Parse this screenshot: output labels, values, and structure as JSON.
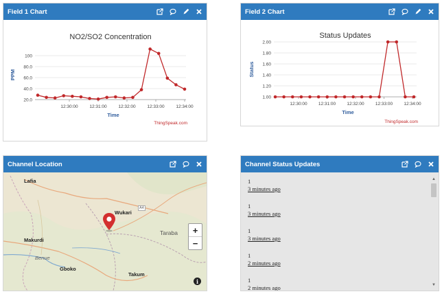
{
  "widgets": {
    "field1": {
      "title": "Field 1 Chart"
    },
    "field2": {
      "title": "Field 2 Chart"
    },
    "location": {
      "title": "Channel Location"
    },
    "status": {
      "title": "Channel Status Updates"
    }
  },
  "icons": {
    "external": "external-link-icon",
    "comment": "comment-icon",
    "edit": "pencil-icon",
    "close": "close-icon"
  },
  "colors": {
    "header": "#2f7bbf",
    "series": "#c0282a",
    "axis_label": "#2f5c9c",
    "credit": "#c0282a"
  },
  "chart_data": [
    {
      "type": "line",
      "title": "NO2/SO2 Concentration",
      "xlabel": "Time",
      "ylabel": "PPM",
      "credit": "ThingSpeak.com",
      "yticks": [
        "20.0",
        "40.0",
        "60.0",
        "80.0",
        "100"
      ],
      "xticks": [
        "12:30:00",
        "12:31:00",
        "12:32:00",
        "12:33:00",
        "12:34:00"
      ],
      "ylim": [
        20,
        110
      ],
      "xlim": [
        0,
        14
      ],
      "x": [
        0,
        0.5,
        1,
        1.5,
        2,
        2.5,
        3,
        3.5,
        4,
        4.5,
        5,
        5.5,
        6,
        6.5,
        7,
        7.5,
        8,
        8.5,
        9,
        9.5,
        10,
        10.5,
        11,
        11.5,
        12,
        12.5,
        13,
        13.5
      ],
      "values": [
        28,
        24,
        23,
        27,
        26,
        25,
        22,
        21,
        24,
        25,
        23,
        24,
        38,
        112,
        104,
        59,
        47,
        39
      ],
      "marker_x_ticks": [
        0.72,
        5.1,
        9.45,
        13.8,
        18.15
      ]
    },
    {
      "type": "line",
      "title": "Status Updates",
      "xlabel": "Time",
      "ylabel": "Status",
      "credit": "ThingSpeak.com",
      "yticks": [
        "1.00",
        "1.20",
        "1.40",
        "1.60",
        "1.80",
        "2.00"
      ],
      "xticks": [
        "12:30:00",
        "12:31:00",
        "12:32:00",
        "12:33:00",
        "12:34:00"
      ],
      "ylim": [
        1.0,
        2.0
      ],
      "values": [
        1,
        1,
        1,
        1,
        1,
        1,
        1,
        1,
        1,
        1,
        1,
        1,
        1,
        2,
        2,
        1,
        1
      ]
    }
  ],
  "map": {
    "labels": {
      "lafia": "Lafia",
      "wukari": "Wukari",
      "makurdi": "Makurdi",
      "taraba": "Taraba",
      "benue": "Benue",
      "gboko": "Gboko",
      "takum": "Takum",
      "road": "A4"
    },
    "zoom_in": "+",
    "zoom_out": "−",
    "info": "i"
  },
  "status_updates": [
    {
      "value": "1",
      "time": "3 minutes ago"
    },
    {
      "value": "1",
      "time": "3 minutes ago"
    },
    {
      "value": "1",
      "time": "3 minutes ago"
    },
    {
      "value": "1",
      "time": "2 minutes ago"
    },
    {
      "value": "1",
      "time": "2 minutes ago"
    }
  ]
}
